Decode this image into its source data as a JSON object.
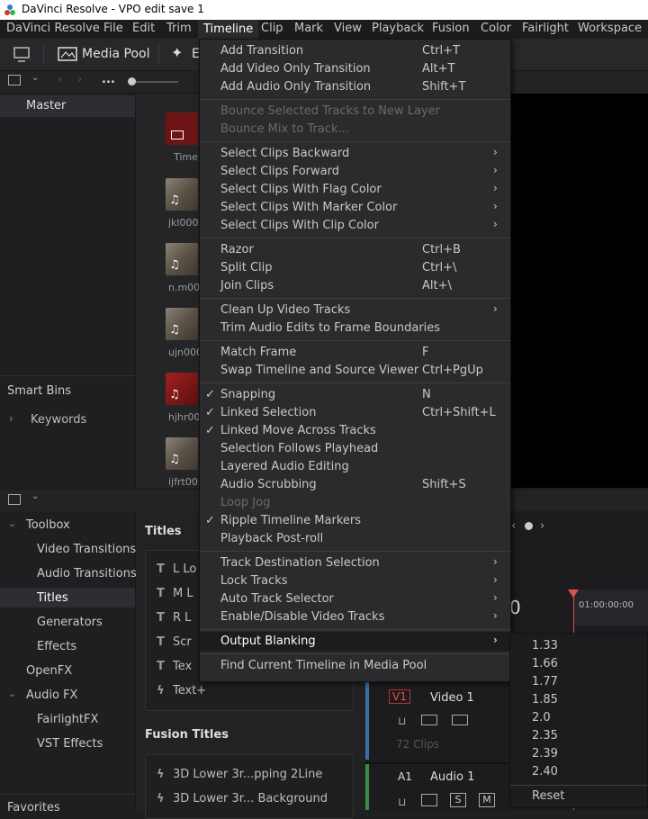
{
  "window": {
    "title": "DaVinci Resolve - VPO edit save 1"
  },
  "menubar": [
    "DaVinci Resolve",
    "File",
    "Edit",
    "Trim",
    "Timeline",
    "Clip",
    "Mark",
    "View",
    "Playback",
    "Fusion",
    "Color",
    "Fairlight",
    "Workspace"
  ],
  "toolbar": {
    "media_pool": "Media Pool",
    "effects_partial": "E"
  },
  "subbar": {
    "more": "..."
  },
  "bins": {
    "master": "Master",
    "smart_bins": "Smart Bins",
    "keywords": "Keywords"
  },
  "clips": [
    {
      "label": "Time"
    },
    {
      "label": "jkl000"
    },
    {
      "label": "n.m00"
    },
    {
      "label": "ujn000"
    },
    {
      "label": "hjhr00"
    },
    {
      "label": "ijfrt00"
    }
  ],
  "toolbox": {
    "items": [
      "Toolbox",
      "Video Transitions",
      "Audio Transitions",
      "Titles",
      "Generators",
      "Effects",
      "OpenFX",
      "Audio FX",
      "FairlightFX",
      "VST Effects",
      "Favorites"
    ]
  },
  "titles_panel": {
    "heading": "Titles",
    "items": [
      "L Lo",
      "M L",
      "R L",
      "Scr",
      "Tex",
      "Text+"
    ],
    "fusion_heading": "Fusion Titles",
    "fusion_items": [
      "3D Lower 3r...pping 2Line",
      "3D Lower 3r... Background"
    ]
  },
  "timeline": {
    "timecode_partial": "0",
    "ruler_time": "01:00:00:00",
    "v1": "V1",
    "video1": "Video 1",
    "clips": "72 Clips",
    "a1": "A1",
    "audio1": "Audio 1",
    "s": "S",
    "m": "M"
  },
  "menu": {
    "items": [
      {
        "label": "Add Transition",
        "shortcut": "Ctrl+T"
      },
      {
        "label": "Add Video Only Transition",
        "shortcut": "Alt+T"
      },
      {
        "label": "Add Audio Only Transition",
        "shortcut": "Shift+T"
      },
      {
        "label": "Bounce Selected Tracks to New Layer",
        "shortcut": ""
      },
      {
        "label": "Bounce Mix to Track...",
        "shortcut": ""
      },
      {
        "label": "Select Clips Backward",
        "shortcut": ""
      },
      {
        "label": "Select Clips Forward",
        "shortcut": ""
      },
      {
        "label": "Select Clips With Flag Color",
        "shortcut": ""
      },
      {
        "label": "Select Clips With Marker Color",
        "shortcut": ""
      },
      {
        "label": "Select Clips With Clip Color",
        "shortcut": ""
      },
      {
        "label": "Razor",
        "shortcut": "Ctrl+B"
      },
      {
        "label": "Split Clip",
        "shortcut": "Ctrl+\\"
      },
      {
        "label": "Join Clips",
        "shortcut": "Alt+\\"
      },
      {
        "label": "Clean Up Video Tracks",
        "shortcut": ""
      },
      {
        "label": "Trim Audio Edits to Frame Boundaries",
        "shortcut": ""
      },
      {
        "label": "Match Frame",
        "shortcut": "F"
      },
      {
        "label": "Swap Timeline and Source Viewer",
        "shortcut": "Ctrl+PgUp"
      },
      {
        "label": "Snapping",
        "shortcut": "N"
      },
      {
        "label": "Linked Selection",
        "shortcut": "Ctrl+Shift+L"
      },
      {
        "label": "Linked Move Across Tracks",
        "shortcut": ""
      },
      {
        "label": "Selection Follows Playhead",
        "shortcut": ""
      },
      {
        "label": "Layered Audio Editing",
        "shortcut": ""
      },
      {
        "label": "Audio Scrubbing",
        "shortcut": "Shift+S"
      },
      {
        "label": "Loop Jog",
        "shortcut": ""
      },
      {
        "label": "Ripple Timeline Markers",
        "shortcut": ""
      },
      {
        "label": "Playback Post-roll",
        "shortcut": ""
      },
      {
        "label": "Track Destination Selection",
        "shortcut": ""
      },
      {
        "label": "Lock Tracks",
        "shortcut": ""
      },
      {
        "label": "Auto Track Selector",
        "shortcut": ""
      },
      {
        "label": "Enable/Disable Video Tracks",
        "shortcut": ""
      },
      {
        "label": "Output Blanking",
        "shortcut": ""
      },
      {
        "label": "Find Current Timeline in Media Pool",
        "shortcut": ""
      }
    ]
  },
  "submenu": {
    "items": [
      "1.33",
      "1.66",
      "1.77",
      "1.85",
      "2.0",
      "2.35",
      "2.39",
      "2.40",
      "Reset"
    ]
  },
  "colors": {
    "accent_red": "#e05050",
    "menu_bg": "#2b2b2e"
  }
}
